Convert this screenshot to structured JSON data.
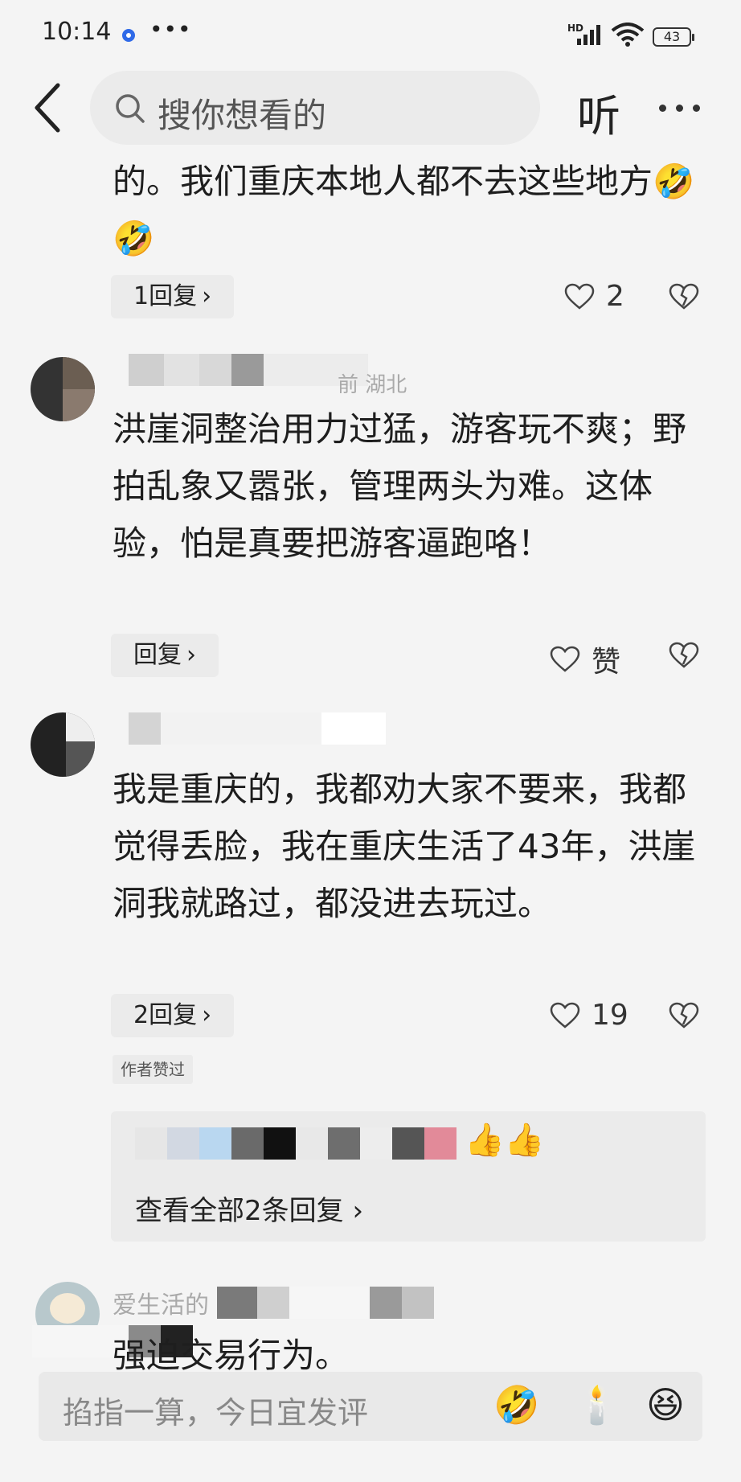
{
  "status_bar": {
    "time": "10:14",
    "more": "•••",
    "hd": "HD",
    "battery": "43"
  },
  "header": {
    "search_placeholder": "搜你想看的",
    "listen_label": "听"
  },
  "comments": [
    {
      "text": "的。我们重庆本地人都不去这些地方",
      "emoji": "🤣🤣",
      "reply_label": "1回复",
      "likes": "2"
    },
    {
      "meta_fragment": "前 湖北",
      "text": "洪崖洞整治用力过猛，游客玩不爽；野拍乱象又嚣张，管理两头为难。这体验，怕是真要把游客逼跑咯！",
      "reply_label": "回复",
      "likes": "赞"
    },
    {
      "text": "我是重庆的，我都劝大家不要来，我都觉得丢脸，我在重庆生活了43年，洪崖洞我就路过，都没进去玩过。",
      "reply_label": "2回复",
      "likes": "19",
      "author_liked": "作者赞过",
      "reply_preview_emoji": "👍👍",
      "view_all_label": "查看全部2条回复"
    },
    {
      "author_fragment": "爱生活的",
      "text": "强迫交易行为。"
    }
  ],
  "bottom_bar": {
    "placeholder": "掐指一算，今日宜发评",
    "emojis": [
      "🤣",
      "🕯️",
      "😆"
    ]
  },
  "colors": {
    "background": "#f4f4f4",
    "pill": "#ebebeb",
    "text": "#1e1e1e"
  }
}
